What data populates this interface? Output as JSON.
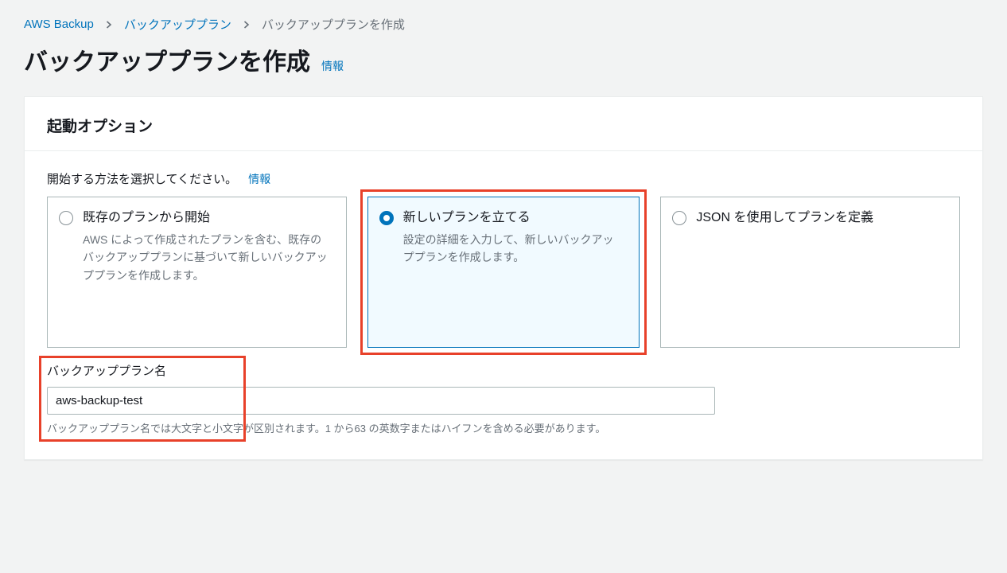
{
  "breadcrumb": {
    "root": "AWS Backup",
    "parent": "バックアッププラン",
    "current": "バックアッププランを作成"
  },
  "page": {
    "title": "バックアッププランを作成",
    "info": "情報"
  },
  "panel": {
    "header": "起動オプション",
    "select_label": "開始する方法を選択してください。",
    "info": "情報",
    "options": [
      {
        "title": "既存のプランから開始",
        "desc": "AWS によって作成されたプランを含む、既存のバックアッププランに基づいて新しいバックアッププランを作成します。"
      },
      {
        "title": "新しいプランを立てる",
        "desc": "設定の詳細を入力して、新しいバックアッププランを作成します。"
      },
      {
        "title": "JSON を使用してプランを定義",
        "desc": ""
      }
    ],
    "name": {
      "label": "バックアッププラン名",
      "value": "aws-backup-test",
      "hint": "バックアッププラン名では大文字と小文字が区別されます。1 から63 の英数字またはハイフンを含める必要があります。"
    }
  }
}
